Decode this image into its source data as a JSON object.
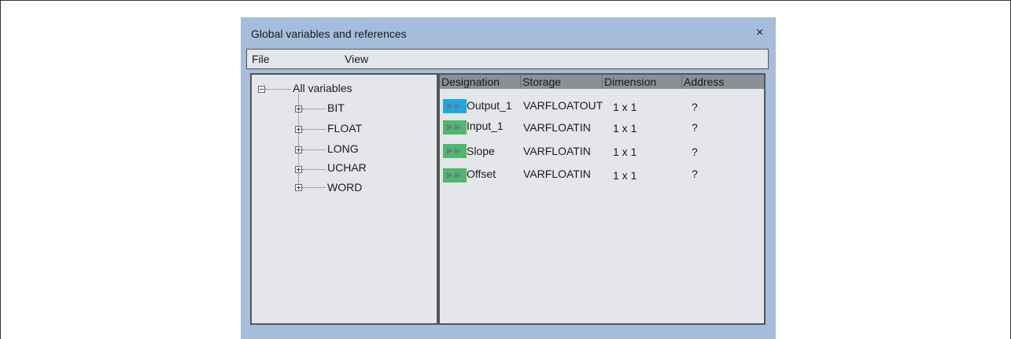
{
  "window": {
    "title": "Global variables and references",
    "close_glyph": "×"
  },
  "menu": [
    {
      "label": "File"
    },
    {
      "label": "View"
    }
  ],
  "tree": {
    "root": {
      "label": "All variables",
      "expanded": true
    },
    "children": [
      {
        "label": "BIT"
      },
      {
        "label": "FLOAT"
      },
      {
        "label": "LONG"
      },
      {
        "label": "UCHAR"
      },
      {
        "label": "WORD"
      }
    ]
  },
  "table": {
    "columns": [
      "Designation",
      "Storage",
      "Dimension",
      "Address"
    ],
    "rows": [
      {
        "designation": "Output_1",
        "storage": "VARFLOATOUT",
        "dimension": "1 x 1",
        "address": "?",
        "icon": "output-arrow-icon",
        "icon_color": "#1ca9e2"
      },
      {
        "designation": "Input_1",
        "storage": "VARFLOATIN",
        "dimension": "1 x 1",
        "address": "?",
        "icon": "input-arrow-icon",
        "icon_color": "#4fb86a"
      },
      {
        "designation": "Slope",
        "storage": "VARFLOATIN",
        "dimension": "1 x 1",
        "address": "?",
        "icon": "input-arrow-icon",
        "icon_color": "#4fb86a"
      },
      {
        "designation": "Offset",
        "storage": "VARFLOATIN",
        "dimension": "1 x 1",
        "address": "?",
        "icon": "input-arrow-icon",
        "icon_color": "#4fb86a"
      }
    ]
  },
  "colors": {
    "window_bg": "#a6bcdb",
    "pane_bg": "#e4e6e9",
    "header_bg": "#8a9097",
    "output_icon": "#1ca9e2",
    "input_icon": "#4fb86a"
  }
}
